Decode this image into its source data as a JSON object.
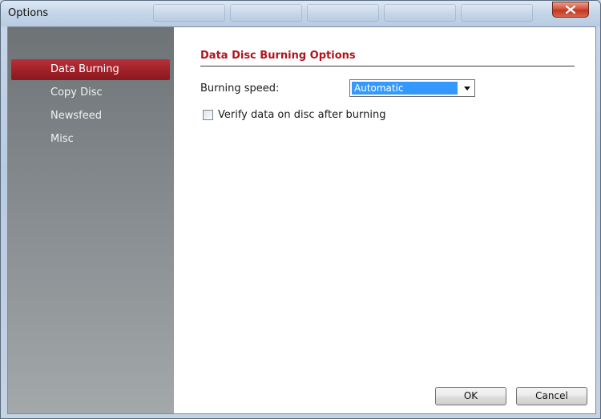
{
  "window": {
    "title": "Options",
    "close_icon": "close-x-icon"
  },
  "sidebar": {
    "items": [
      {
        "label": "Data Burning",
        "active": true
      },
      {
        "label": "Copy Disc",
        "active": false
      },
      {
        "label": "Newsfeed",
        "active": false
      },
      {
        "label": "Misc",
        "active": false
      }
    ]
  },
  "content": {
    "section_title": "Data Disc Burning Options",
    "burning_speed_label": "Burning speed:",
    "burning_speed_value": "Automatic",
    "verify_label": "Verify data on disc after burning",
    "verify_checked": false
  },
  "buttons": {
    "ok": "OK",
    "cancel": "Cancel"
  },
  "colors": {
    "accent_red": "#b3121d",
    "active_item": "#9e1f27",
    "selection_blue": "#3399ff"
  }
}
